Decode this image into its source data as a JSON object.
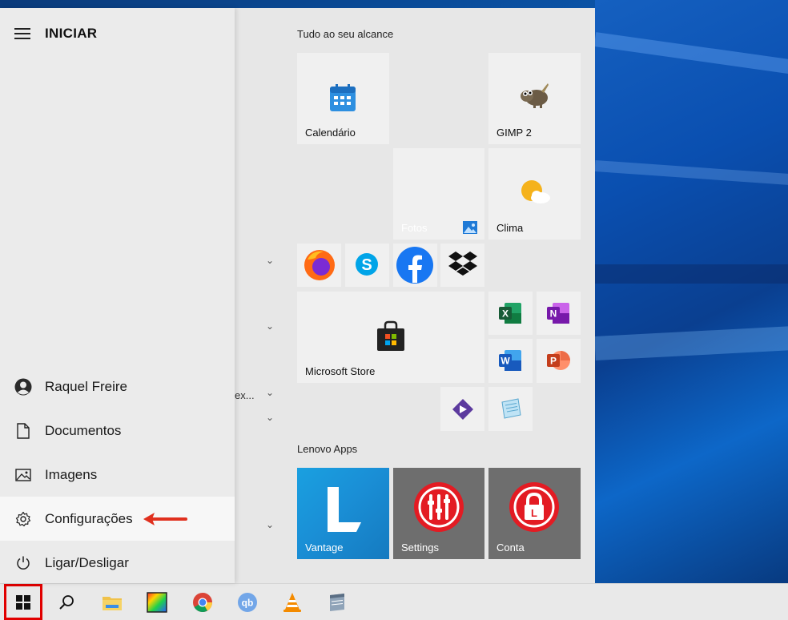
{
  "start_menu": {
    "title": "INICIAR",
    "user": "Raquel Freire",
    "items": [
      {
        "label": "Documentos",
        "icon": "document-icon"
      },
      {
        "label": "Imagens",
        "icon": "image-icon"
      },
      {
        "label": "Configurações",
        "icon": "gear-icon"
      },
      {
        "label": "Ligar/Desligar",
        "icon": "power-icon"
      }
    ],
    "truncated_app": "ex..."
  },
  "groups": {
    "group1_title": "Tudo ao seu alcance",
    "group2_title": "Lenovo Apps"
  },
  "tiles": {
    "calendario": "Calendário",
    "gimp": "GIMP 2",
    "fotos": "Fotos",
    "clima": "Clima",
    "store": "Microsoft Store",
    "vantage": "Vantage",
    "settings": "Settings",
    "conta": "Conta"
  },
  "taskbar": {
    "icons": [
      "windows-start-icon",
      "search-icon",
      "file-explorer-icon",
      "photo-app-icon",
      "chrome-icon",
      "qbittorrent-icon",
      "vlc-icon",
      "archive-icon"
    ]
  },
  "colors": {
    "accent_red": "#e10000",
    "tile_bg": "#f0f0f0",
    "vantage_blue": "#1a8fd6",
    "lenovo_gray": "#6e6e6e",
    "lenovo_red": "#e31b23"
  }
}
